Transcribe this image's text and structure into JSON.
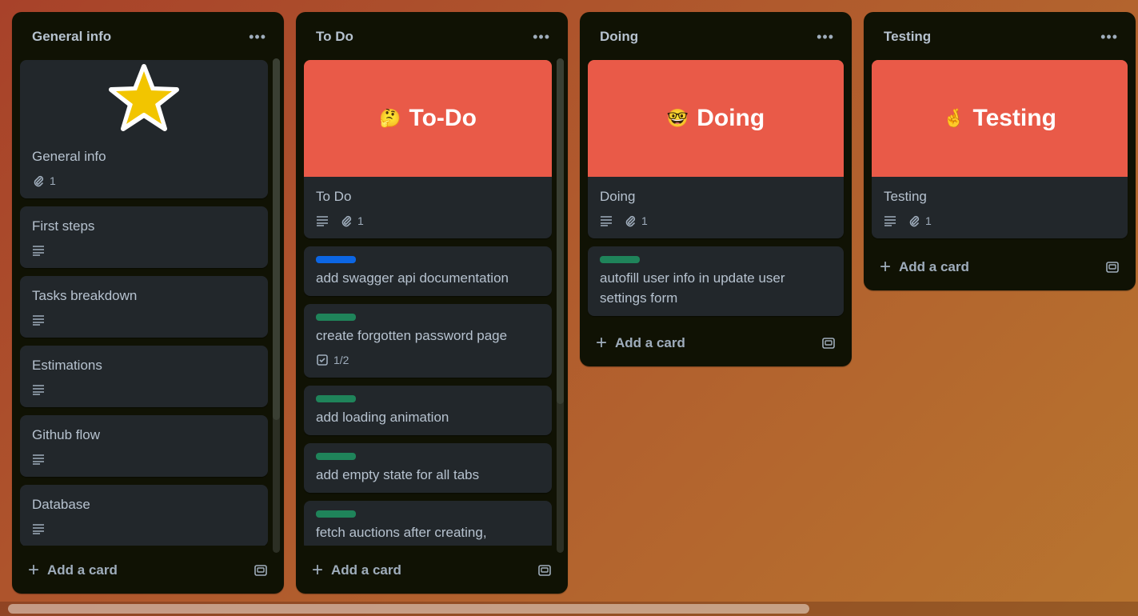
{
  "lists": [
    {
      "title": "General info",
      "add_label": "Add a card",
      "cards": [
        {
          "title": "General info",
          "attachments": "1"
        },
        {
          "title": "First steps"
        },
        {
          "title": "Tasks breakdown"
        },
        {
          "title": "Estimations"
        },
        {
          "title": "Github flow"
        },
        {
          "title": "Database"
        }
      ]
    },
    {
      "title": "To Do",
      "add_label": "Add a card",
      "cover": {
        "emoji": "🤔",
        "text": "To-Do",
        "color": "#e95a48"
      },
      "cards": [
        {
          "title": "To Do",
          "attachments": "1"
        },
        {
          "title": "add swagger api documentation",
          "label_color": "#0c66e4"
        },
        {
          "title": "create forgotten password page",
          "label_color": "#1f845a",
          "checklist": "1/2"
        },
        {
          "title": "add loading animation",
          "label_color": "#1f845a"
        },
        {
          "title": "add empty state for all tabs",
          "label_color": "#1f845a"
        },
        {
          "title": "fetch auctions after creating,",
          "label_color": "#1f845a"
        }
      ]
    },
    {
      "title": "Doing",
      "add_label": "Add a card",
      "cover": {
        "emoji": "🤓",
        "text": "Doing",
        "color": "#e95a48"
      },
      "cards": [
        {
          "title": "Doing",
          "attachments": "1"
        },
        {
          "title": "autofill user info in update user settings form",
          "label_color": "#1f845a"
        }
      ]
    },
    {
      "title": "Testing",
      "add_label": "Add a card",
      "cover": {
        "emoji": "🤞",
        "text": "Testing",
        "color": "#e95a48"
      },
      "cards": [
        {
          "title": "Testing",
          "attachments": "1"
        }
      ]
    }
  ],
  "icons": {
    "list_menu": "more-dots-icon",
    "description": "description-icon",
    "attachment": "paperclip-icon",
    "checklist": "checklist-icon",
    "template": "template-icon",
    "plus": "plus-icon"
  }
}
